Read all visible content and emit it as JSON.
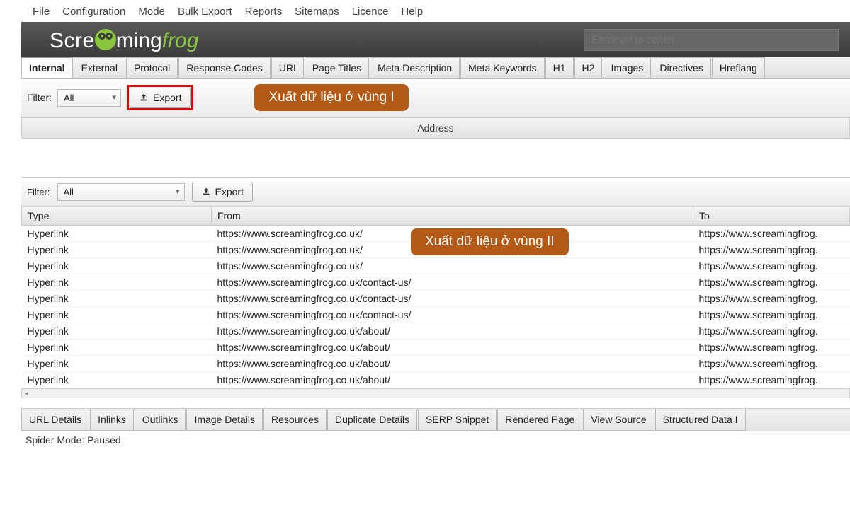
{
  "menu": [
    "File",
    "Configuration",
    "Mode",
    "Bulk Export",
    "Reports",
    "Sitemaps",
    "Licence",
    "Help"
  ],
  "brand": {
    "part1": "Scre",
    "part2": "ming",
    "part3": "frog"
  },
  "url_input": {
    "placeholder": "Enter url to spider"
  },
  "top_tabs": [
    "Internal",
    "External",
    "Protocol",
    "Response Codes",
    "URI",
    "Page Titles",
    "Meta Description",
    "Meta Keywords",
    "H1",
    "H2",
    "Images",
    "Directives",
    "Hreflang"
  ],
  "top_tabs_active": "Internal",
  "filter1": {
    "label": "Filter:",
    "value": "All",
    "export_label": "Export"
  },
  "callout1": "Xuất dữ liệu ở vùng I",
  "grid_header": "Address",
  "filter2": {
    "label": "Filter:",
    "value": "All",
    "export_label": "Export"
  },
  "callout2": "Xuất dữ liệu ở vùng II",
  "table": {
    "columns": [
      "Type",
      "From",
      "To"
    ],
    "rows": [
      {
        "type": "Hyperlink",
        "from": "https://www.screamingfrog.co.uk/",
        "to": "https://www.screamingfrog."
      },
      {
        "type": "Hyperlink",
        "from": "https://www.screamingfrog.co.uk/",
        "to": "https://www.screamingfrog."
      },
      {
        "type": "Hyperlink",
        "from": "https://www.screamingfrog.co.uk/",
        "to": "https://www.screamingfrog."
      },
      {
        "type": "Hyperlink",
        "from": "https://www.screamingfrog.co.uk/contact-us/",
        "to": "https://www.screamingfrog."
      },
      {
        "type": "Hyperlink",
        "from": "https://www.screamingfrog.co.uk/contact-us/",
        "to": "https://www.screamingfrog."
      },
      {
        "type": "Hyperlink",
        "from": "https://www.screamingfrog.co.uk/contact-us/",
        "to": "https://www.screamingfrog."
      },
      {
        "type": "Hyperlink",
        "from": "https://www.screamingfrog.co.uk/about/",
        "to": "https://www.screamingfrog."
      },
      {
        "type": "Hyperlink",
        "from": "https://www.screamingfrog.co.uk/about/",
        "to": "https://www.screamingfrog."
      },
      {
        "type": "Hyperlink",
        "from": "https://www.screamingfrog.co.uk/about/",
        "to": "https://www.screamingfrog."
      },
      {
        "type": "Hyperlink",
        "from": "https://www.screamingfrog.co.uk/about/",
        "to": "https://www.screamingfrog."
      }
    ]
  },
  "bottom_tabs": [
    "URL Details",
    "Inlinks",
    "Outlinks",
    "Image Details",
    "Resources",
    "Duplicate Details",
    "SERP Snippet",
    "Rendered Page",
    "View Source",
    "Structured Data I"
  ],
  "status": "Spider Mode: Paused"
}
